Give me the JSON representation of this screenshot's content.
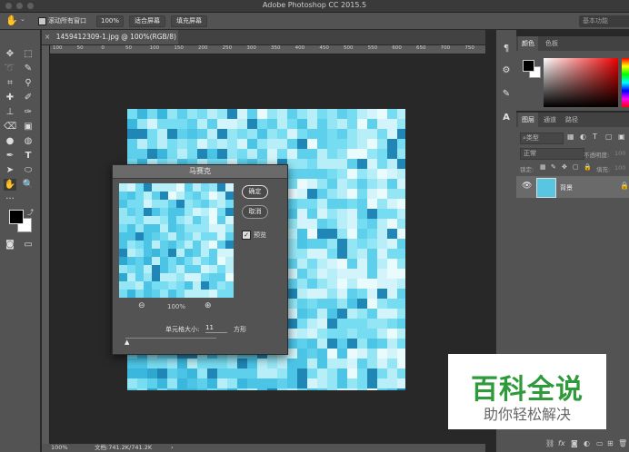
{
  "app": {
    "window_title": "Adobe Photoshop CC 2015.5"
  },
  "options_bar": {
    "scroll_all_label": "滚动所有窗口",
    "zoom_value": "100%",
    "fit_screen_label": "适合屏幕",
    "fill_screen_label": "填充屏幕",
    "workspace_label": "基本功能"
  },
  "document": {
    "tab_title": "1459412309-1.jpg @ 100%(RGB/8) *",
    "ruler_labels": [
      "100",
      "50",
      "0",
      "50",
      "100",
      "150",
      "200",
      "250",
      "300",
      "350",
      "400",
      "450",
      "500",
      "550",
      "600",
      "650",
      "700",
      "750"
    ]
  },
  "status_bar": {
    "zoom": "100%",
    "doc_info": "文档:741.2K/741.2K"
  },
  "color_panel": {
    "tabs": [
      "颜色",
      "色板"
    ],
    "fg_color": "#000000",
    "bg_color": "#ffffff"
  },
  "layers_panel": {
    "tabs": [
      "图层",
      "通道",
      "路径"
    ],
    "filter_kind": "类型",
    "blend_mode": "正常",
    "opacity_label": "不透明度:",
    "opacity_value": "100",
    "lock_label": "锁定:",
    "fill_label": "填充:",
    "fill_value": "100",
    "layer_name": "背景"
  },
  "mosaic_dialog": {
    "title": "马赛克",
    "ok_label": "确定",
    "cancel_label": "取消",
    "preview_label": "预览",
    "preview_checked": true,
    "zoom_value": "100%",
    "cell_size_label": "单元格大小:",
    "cell_size_value": "11",
    "unit_label": "方形"
  },
  "watermark": {
    "main": "百科全说",
    "sub": "助你轻松解决"
  }
}
